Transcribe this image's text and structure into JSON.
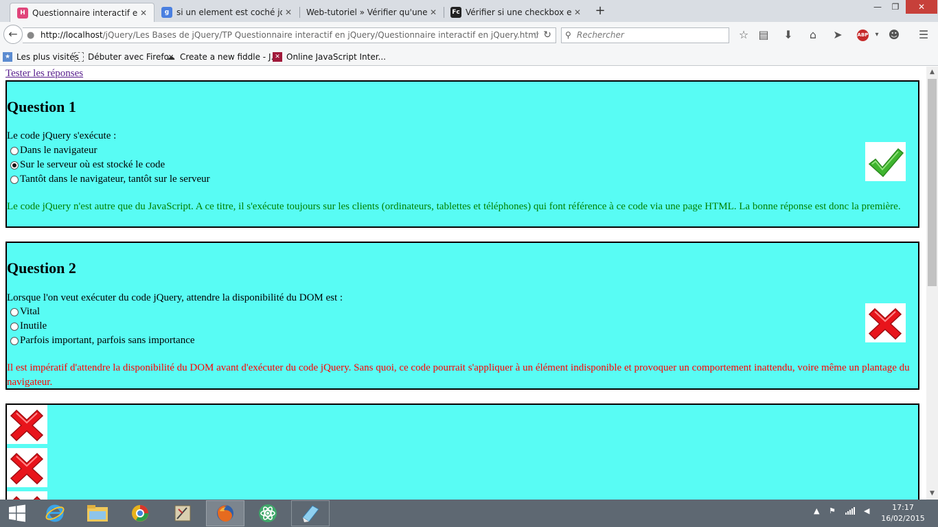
{
  "browser": {
    "tabs": [
      {
        "title": "Questionnaire interactif en ...",
        "favicon": "html-icon"
      },
      {
        "title": "si un element est coché jq...",
        "favicon": "google-icon"
      },
      {
        "title": "Web-tutoriel » Vérifier qu'une c...",
        "favicon": "none"
      },
      {
        "title": "Vérifier si une checkbox est...",
        "favicon": "fc-icon"
      }
    ],
    "url_host": "http://localhost",
    "url_path": "/jQuery/Les Bases de jQuery/TP Questionnaire interactif en jQuery/Questionnaire interactif en jQuery.html",
    "search_placeholder": "Rechercher",
    "bookmarks": [
      {
        "label": "Les plus visités"
      },
      {
        "label": "Débuter avec Firefox"
      },
      {
        "label": "Create a new fiddle - J..."
      },
      {
        "label": "Online JavaScript Inter..."
      }
    ]
  },
  "page": {
    "test_link": "Tester les réponses",
    "questions": [
      {
        "title": "Question 1",
        "prompt": "Le code jQuery s'exécute :",
        "options": [
          {
            "label": "Dans le navigateur",
            "checked": false
          },
          {
            "label": "Sur le serveur où est stocké le code",
            "checked": true
          },
          {
            "label": "Tantôt dans le navigateur, tantôt sur le serveur",
            "checked": false
          }
        ],
        "explanation": "Le code jQuery n'est autre que du JavaScript. A ce titre, il s'exécute toujours sur les clients (ordinateurs, tablettes et téléphones) qui font référence à ce code via une page HTML. La bonne réponse est donc la première.",
        "explanation_color": "#008000",
        "result_icon": "checkmark-icon"
      },
      {
        "title": "Question 2",
        "prompt": "Lorsque l'on veut exécuter du code jQuery, attendre la disponibilité du DOM est :",
        "options": [
          {
            "label": "Vital",
            "checked": false
          },
          {
            "label": "Inutile",
            "checked": false
          },
          {
            "label": "Parfois important, parfois sans importance",
            "checked": false
          }
        ],
        "explanation": "Il est impératif d'attendre la disponibilité du DOM avant d'exécuter du code jQuery. Sans quoi, ce code pourrait s'appliquer à un élément indisponible et provoquer un comportement inattendu, voire même un plantage du navigateur.",
        "explanation_color": "#ff0000",
        "result_icon": "cross-icon"
      }
    ],
    "third_box_icons": [
      "cross-icon",
      "cross-icon",
      "cross-icon"
    ],
    "box_color": "#58fcf4"
  },
  "taskbar": {
    "time": "17:17",
    "date": "16/02/2015"
  }
}
